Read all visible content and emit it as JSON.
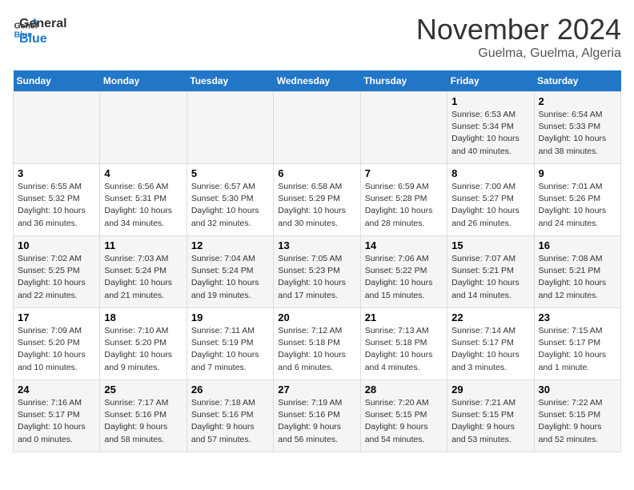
{
  "header": {
    "logo_line1": "General",
    "logo_line2": "Blue",
    "month": "November 2024",
    "location": "Guelma, Guelma, Algeria"
  },
  "days_of_week": [
    "Sunday",
    "Monday",
    "Tuesday",
    "Wednesday",
    "Thursday",
    "Friday",
    "Saturday"
  ],
  "weeks": [
    [
      {
        "day": "",
        "info": ""
      },
      {
        "day": "",
        "info": ""
      },
      {
        "day": "",
        "info": ""
      },
      {
        "day": "",
        "info": ""
      },
      {
        "day": "",
        "info": ""
      },
      {
        "day": "1",
        "info": "Sunrise: 6:53 AM\nSunset: 5:34 PM\nDaylight: 10 hours and 40 minutes."
      },
      {
        "day": "2",
        "info": "Sunrise: 6:54 AM\nSunset: 5:33 PM\nDaylight: 10 hours and 38 minutes."
      }
    ],
    [
      {
        "day": "3",
        "info": "Sunrise: 6:55 AM\nSunset: 5:32 PM\nDaylight: 10 hours and 36 minutes."
      },
      {
        "day": "4",
        "info": "Sunrise: 6:56 AM\nSunset: 5:31 PM\nDaylight: 10 hours and 34 minutes."
      },
      {
        "day": "5",
        "info": "Sunrise: 6:57 AM\nSunset: 5:30 PM\nDaylight: 10 hours and 32 minutes."
      },
      {
        "day": "6",
        "info": "Sunrise: 6:58 AM\nSunset: 5:29 PM\nDaylight: 10 hours and 30 minutes."
      },
      {
        "day": "7",
        "info": "Sunrise: 6:59 AM\nSunset: 5:28 PM\nDaylight: 10 hours and 28 minutes."
      },
      {
        "day": "8",
        "info": "Sunrise: 7:00 AM\nSunset: 5:27 PM\nDaylight: 10 hours and 26 minutes."
      },
      {
        "day": "9",
        "info": "Sunrise: 7:01 AM\nSunset: 5:26 PM\nDaylight: 10 hours and 24 minutes."
      }
    ],
    [
      {
        "day": "10",
        "info": "Sunrise: 7:02 AM\nSunset: 5:25 PM\nDaylight: 10 hours and 22 minutes."
      },
      {
        "day": "11",
        "info": "Sunrise: 7:03 AM\nSunset: 5:24 PM\nDaylight: 10 hours and 21 minutes."
      },
      {
        "day": "12",
        "info": "Sunrise: 7:04 AM\nSunset: 5:24 PM\nDaylight: 10 hours and 19 minutes."
      },
      {
        "day": "13",
        "info": "Sunrise: 7:05 AM\nSunset: 5:23 PM\nDaylight: 10 hours and 17 minutes."
      },
      {
        "day": "14",
        "info": "Sunrise: 7:06 AM\nSunset: 5:22 PM\nDaylight: 10 hours and 15 minutes."
      },
      {
        "day": "15",
        "info": "Sunrise: 7:07 AM\nSunset: 5:21 PM\nDaylight: 10 hours and 14 minutes."
      },
      {
        "day": "16",
        "info": "Sunrise: 7:08 AM\nSunset: 5:21 PM\nDaylight: 10 hours and 12 minutes."
      }
    ],
    [
      {
        "day": "17",
        "info": "Sunrise: 7:09 AM\nSunset: 5:20 PM\nDaylight: 10 hours and 10 minutes."
      },
      {
        "day": "18",
        "info": "Sunrise: 7:10 AM\nSunset: 5:20 PM\nDaylight: 10 hours and 9 minutes."
      },
      {
        "day": "19",
        "info": "Sunrise: 7:11 AM\nSunset: 5:19 PM\nDaylight: 10 hours and 7 minutes."
      },
      {
        "day": "20",
        "info": "Sunrise: 7:12 AM\nSunset: 5:18 PM\nDaylight: 10 hours and 6 minutes."
      },
      {
        "day": "21",
        "info": "Sunrise: 7:13 AM\nSunset: 5:18 PM\nDaylight: 10 hours and 4 minutes."
      },
      {
        "day": "22",
        "info": "Sunrise: 7:14 AM\nSunset: 5:17 PM\nDaylight: 10 hours and 3 minutes."
      },
      {
        "day": "23",
        "info": "Sunrise: 7:15 AM\nSunset: 5:17 PM\nDaylight: 10 hours and 1 minute."
      }
    ],
    [
      {
        "day": "24",
        "info": "Sunrise: 7:16 AM\nSunset: 5:17 PM\nDaylight: 10 hours and 0 minutes."
      },
      {
        "day": "25",
        "info": "Sunrise: 7:17 AM\nSunset: 5:16 PM\nDaylight: 9 hours and 58 minutes."
      },
      {
        "day": "26",
        "info": "Sunrise: 7:18 AM\nSunset: 5:16 PM\nDaylight: 9 hours and 57 minutes."
      },
      {
        "day": "27",
        "info": "Sunrise: 7:19 AM\nSunset: 5:16 PM\nDaylight: 9 hours and 56 minutes."
      },
      {
        "day": "28",
        "info": "Sunrise: 7:20 AM\nSunset: 5:15 PM\nDaylight: 9 hours and 54 minutes."
      },
      {
        "day": "29",
        "info": "Sunrise: 7:21 AM\nSunset: 5:15 PM\nDaylight: 9 hours and 53 minutes."
      },
      {
        "day": "30",
        "info": "Sunrise: 7:22 AM\nSunset: 5:15 PM\nDaylight: 9 hours and 52 minutes."
      }
    ]
  ]
}
